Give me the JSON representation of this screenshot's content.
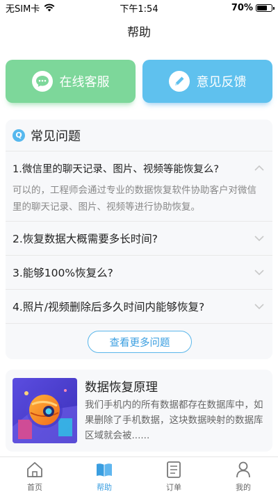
{
  "status_bar": {
    "carrier": "无SIM卡",
    "time": "下午1:54",
    "battery": "70%",
    "battery_level": 0.7
  },
  "nav": {
    "title": "帮助"
  },
  "actions": {
    "service_label": "在线客服",
    "feedback_label": "意见反馈"
  },
  "faq": {
    "title": "常见问题",
    "items": [
      {
        "question": "1.微信里的聊天记录、图片、视频等能恢复么?",
        "answer": "可以的，工程师会通过专业的数据恢复软件协助客户对微信里的聊天记录、图片、视频等进行协助恢复。",
        "expanded": true
      },
      {
        "question": "2.恢复数据大概需要多长时间?",
        "expanded": false
      },
      {
        "question": "3.能够100%恢复么?",
        "expanded": false
      },
      {
        "question": "4.照片/视频删除后多久时间内能够恢复?",
        "expanded": false
      }
    ],
    "more_label": "查看更多问题"
  },
  "info": {
    "title": "数据恢复原理",
    "description": "我们手机内的所有数据都存在数据库中，如果删除了手机数据，这块数据映射的数据库区域就会被......"
  },
  "tabs": [
    {
      "label": "首页",
      "icon": "home-icon",
      "active": false
    },
    {
      "label": "帮助",
      "icon": "book-icon",
      "active": true
    },
    {
      "label": "订单",
      "icon": "order-icon",
      "active": false
    },
    {
      "label": "我的",
      "icon": "user-icon",
      "active": false
    }
  ],
  "colors": {
    "accent": "#3a9ee0",
    "service_green": "#7dd79a",
    "feedback_blue": "#5fc1ee"
  }
}
